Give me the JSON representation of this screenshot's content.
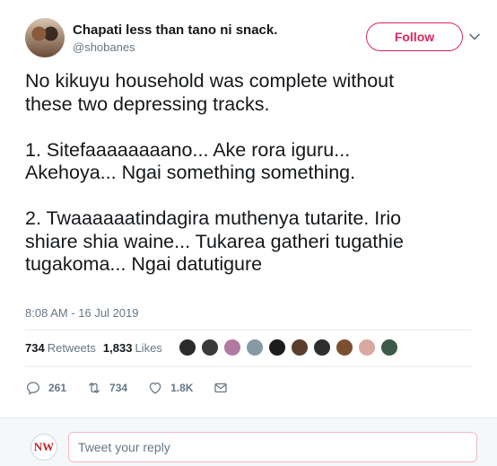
{
  "user": {
    "display_name": "Chapati less than tano ni snack.",
    "handle": "@shobanes",
    "follow_label": "Follow"
  },
  "tweet": {
    "text": "No kikuyu household was complete without\nthese two depressing tracks.\n\n1. Sitefaaaaaaaano... Ake rora iguru...\nAkehoya... Ngai something something.\n\n2. Twaaaaaatindagira muthenya tutarite. Irio\nshiare shia waine... Tukarea gatheri tugathie\ntugakoma... Ngai datutigure",
    "timestamp": "8:08 AM - 16 Jul 2019"
  },
  "stats": {
    "retweets_count": "734",
    "retweets_label": "Retweets",
    "likes_count": "1,833",
    "likes_label": "Likes",
    "liker_colors": [
      "#2b2b2b",
      "#3a3a3a",
      "#b07aa1",
      "#8899a6",
      "#1c1c1c",
      "#5a3d2b",
      "#2e2e2e",
      "#7a5030",
      "#d9a8a0",
      "#3d5a48"
    ]
  },
  "actions": {
    "reply_count": "261",
    "retweet_count": "734",
    "like_count": "1.8K"
  },
  "reply": {
    "avatar_text": "NW",
    "placeholder": "Tweet your reply"
  },
  "colors": {
    "accent": "#e0245e",
    "secondary_text": "#657786",
    "divider": "#e6ecf0"
  },
  "icons": [
    "chevron-down-icon",
    "reply-icon",
    "retweet-icon",
    "like-icon",
    "dm-icon"
  ]
}
